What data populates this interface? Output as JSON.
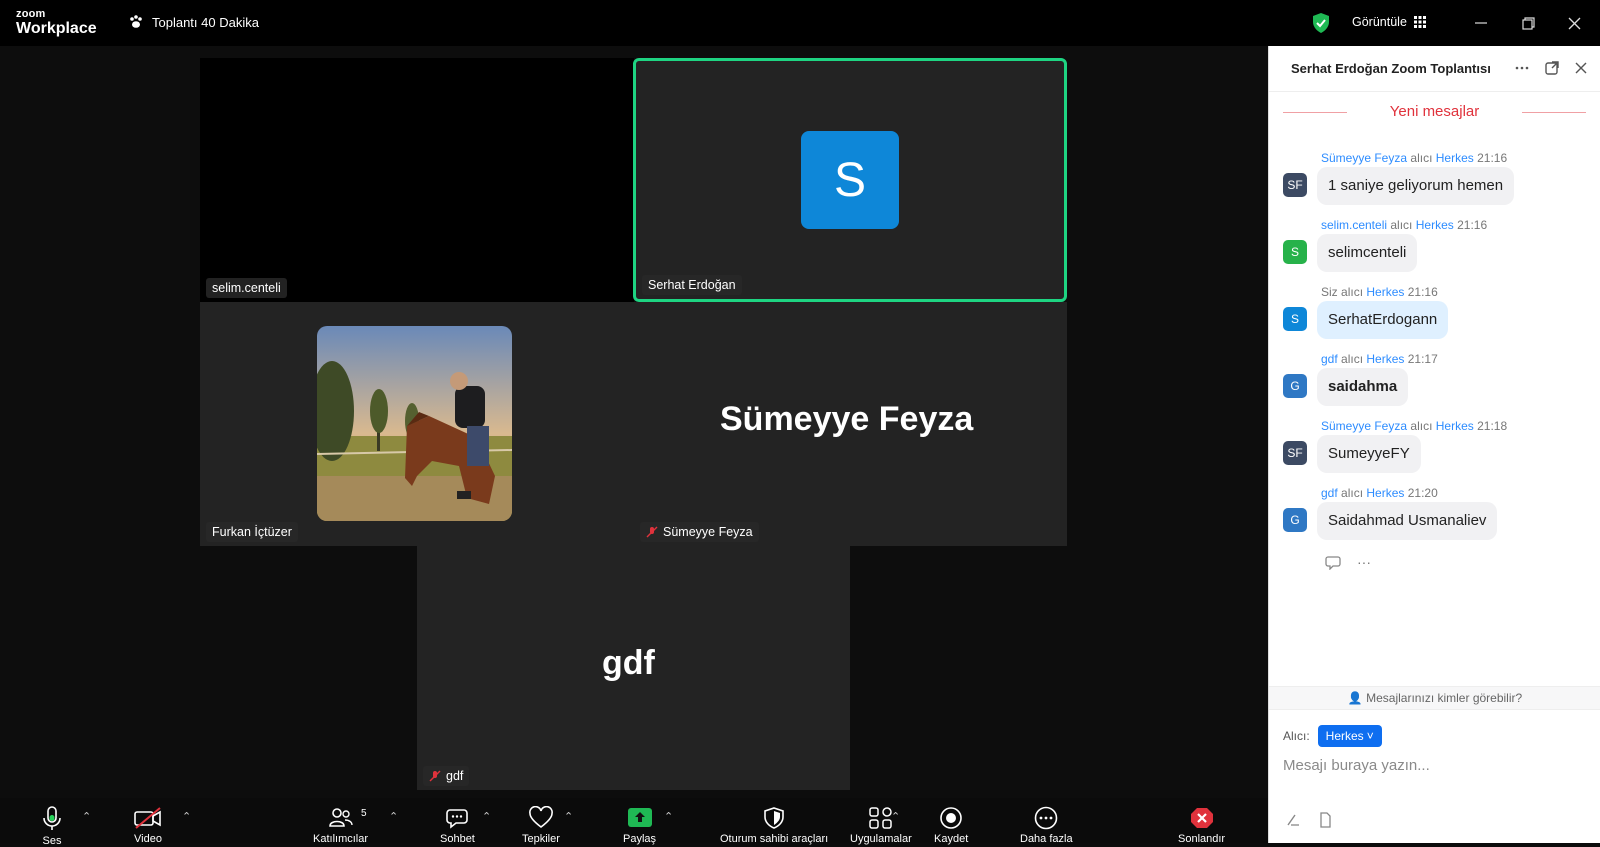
{
  "app": {
    "logo_small": "zoom",
    "logo_big": "Workplace",
    "meeting_title": "Toplantı 40 Dakika",
    "view_label": "Görüntüle"
  },
  "tiles": {
    "selim": "selim.centeli",
    "serhat": "Serhat Erdoğan",
    "serhat_initial": "S",
    "furkan": "Furkan İçtüzer",
    "sumeyye_big": "Sümeyye Feyza",
    "sumeyye_tag": "Sümeyye Feyza",
    "gdf_big": "gdf",
    "gdf_tag": "gdf"
  },
  "toolbar": {
    "mute": "Ses",
    "video": "Video",
    "participants": "Katılımcılar",
    "participants_count": "5",
    "chat": "Sohbet",
    "react": "Tepkiler",
    "share": "Paylaş",
    "host_tools": "Oturum sahibi araçları",
    "apps": "Uygulamalar",
    "record": "Kaydet",
    "more": "Daha fazla",
    "end": "Sonlandır"
  },
  "chat": {
    "title": "Serhat Erdoğan Zoom Toplantısı",
    "new_messages": "Yeni mesajlar",
    "to_word": "alıcı",
    "messages": [
      {
        "sender": "Sümeyye Feyza",
        "to": "Herkes",
        "time": "21:16",
        "initials": "SF",
        "text": "1 saniye geliyorum hemen",
        "color": "#3c4a63"
      },
      {
        "sender": "selim.centeli",
        "to": "Herkes",
        "time": "21:16",
        "initials": "S",
        "text": "selimcenteli",
        "color": "#27b24a"
      },
      {
        "sender": "Siz",
        "to": "Herkes",
        "time": "21:16",
        "initials": "S",
        "text": "SerhatErdogann",
        "color": "#0e87d8"
      },
      {
        "sender": "gdf",
        "to": "Herkes",
        "time": "21:17",
        "initials": "G",
        "text": "saidahma",
        "color": "#2f78c4"
      },
      {
        "sender": "Sümeyye Feyza",
        "to": "Herkes",
        "time": "21:18",
        "initials": "SF",
        "text": "SumeyyeFY",
        "color": "#3c4a63"
      },
      {
        "sender": "gdf",
        "to": "Herkes",
        "time": "21:20",
        "initials": "G",
        "text": "Saidahmad Usmanaliev",
        "color": "#2f78c4"
      }
    ],
    "privacy": "Mesajlarınızı kimler görebilir?",
    "to_label": "Alıcı:",
    "to_value": "Herkes",
    "placeholder": "Mesajı buraya yazın..."
  },
  "colors": {
    "active_speaker": "#1ed482",
    "accent": "#0e6ef0",
    "new_messages": "#e0323c"
  }
}
